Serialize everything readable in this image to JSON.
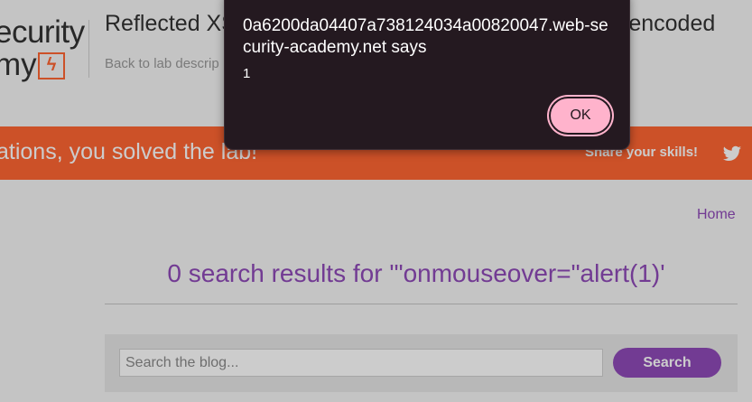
{
  "header": {
    "logo_line1": "ecurity",
    "logo_line2": "my",
    "logo_bolt": "ϟ",
    "lab_title": "Reflected XS",
    "lab_title_tail": "-encoded",
    "back_link": "Back to lab descrip"
  },
  "banner": {
    "message": "ations, you solved the lab!",
    "share_label": "Share your skills!",
    "share_icon": "twitter-icon"
  },
  "nav": {
    "home_label": "Home"
  },
  "results": {
    "heading": "0 search results for '\"onmouseover=\"alert(1)'"
  },
  "search": {
    "placeholder": "Search the blog...",
    "value": "",
    "button_label": "Search"
  },
  "dialog": {
    "origin": "0a6200da04407a738124034a00820047.web-security-academy.net says",
    "message": "1",
    "ok_label": "OK"
  },
  "colors": {
    "banner": "#ff6633",
    "accent": "#8f4ab8",
    "dialog_bg": "#241920",
    "ok_button": "#ffb3cc"
  }
}
